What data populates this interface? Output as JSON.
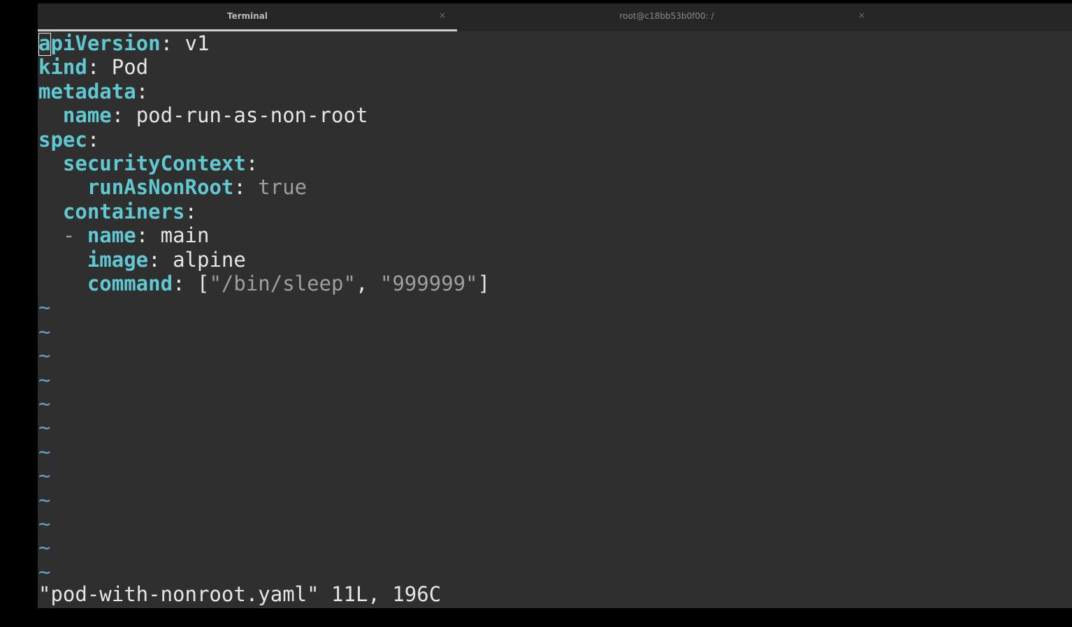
{
  "tabs": [
    {
      "label": "Terminal",
      "close": "×",
      "active": true
    },
    {
      "label": "root@c18bb53b0f00: /",
      "close": "×",
      "active": false
    }
  ],
  "editor": {
    "lines": [
      {
        "indent": "",
        "prefix": "",
        "key": "apiVersion",
        "sep": ": ",
        "value": "v1"
      },
      {
        "indent": "",
        "prefix": "",
        "key": "kind",
        "sep": ": ",
        "value": "Pod"
      },
      {
        "indent": "",
        "prefix": "",
        "key": "metadata",
        "sep": ":",
        "value": ""
      },
      {
        "indent": "  ",
        "prefix": "",
        "key": "name",
        "sep": ": ",
        "value": "pod-run-as-non-root"
      },
      {
        "indent": "",
        "prefix": "",
        "key": "spec",
        "sep": ":",
        "value": ""
      },
      {
        "indent": "  ",
        "prefix": "",
        "key": "securityContext",
        "sep": ":",
        "value": ""
      },
      {
        "indent": "    ",
        "prefix": "",
        "key": "runAsNonRoot",
        "sep": ": ",
        "value": "true"
      },
      {
        "indent": "  ",
        "prefix": "",
        "key": "containers",
        "sep": ":",
        "value": ""
      },
      {
        "indent": "  ",
        "prefix": "- ",
        "key": "name",
        "sep": ": ",
        "value": "main"
      },
      {
        "indent": "    ",
        "prefix": "",
        "key": "image",
        "sep": ": ",
        "value": "alpine"
      },
      {
        "indent": "    ",
        "prefix": "",
        "key": "command",
        "sep": ": ",
        "value": ""
      }
    ],
    "command_array": {
      "open": "[",
      "items": [
        "\"/bin/sleep\"",
        "\"999999\""
      ],
      "separator": ", ",
      "close": "]"
    },
    "empty_line_marker": "~",
    "empty_line_count": 12,
    "status_line": "\"pod-with-nonroot.yaml\" 11L, 196C"
  },
  "colors": {
    "key": "#5fc8d1",
    "boolean": "#9aa0a3",
    "string": "#9aa0a3",
    "tilde": "#5fa3c8",
    "text": "#e6e6e6",
    "background": "#2f2f2f"
  }
}
